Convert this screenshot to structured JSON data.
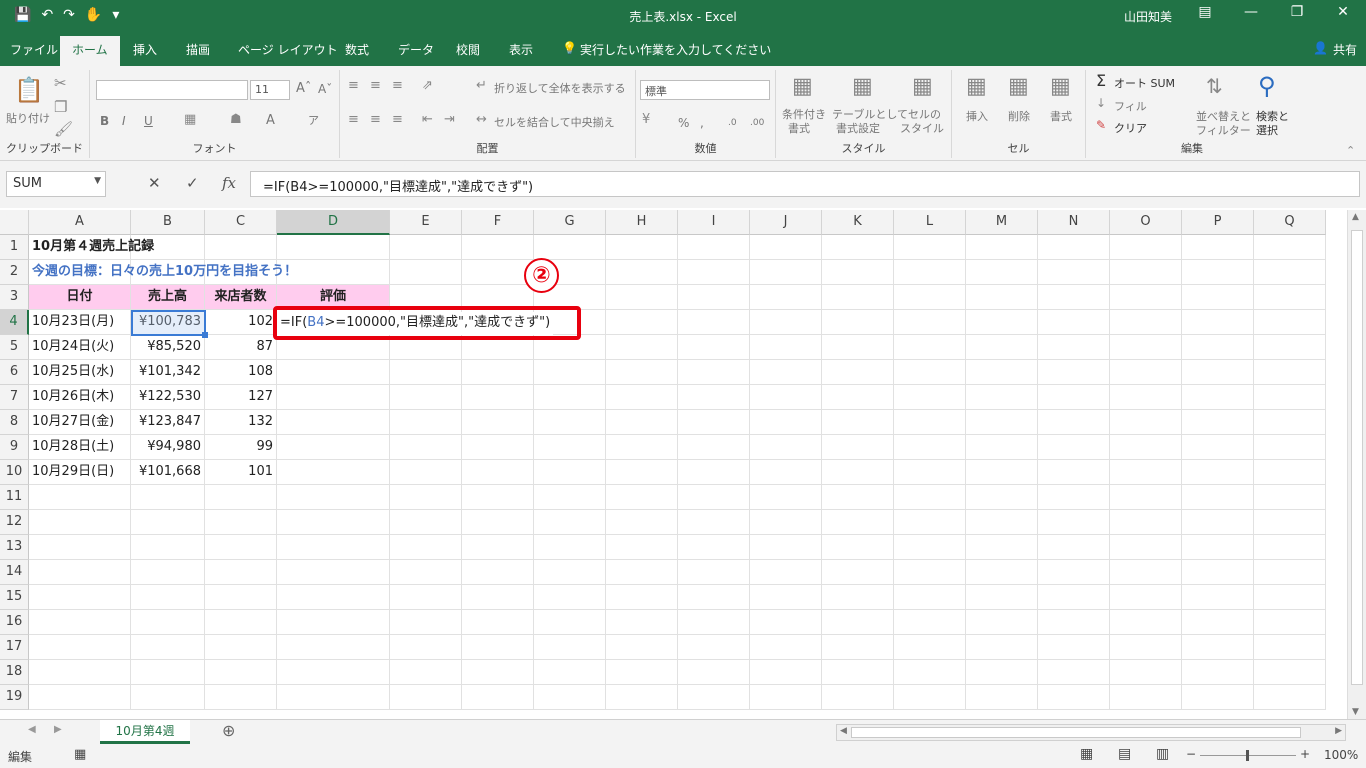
{
  "window": {
    "title": "売上表.xlsx  -  Excel",
    "user": "山田知美",
    "share": "共有"
  },
  "qat": {
    "save_icon": "save-icon",
    "undo_icon": "undo-icon",
    "redo_icon": "redo-icon",
    "touch_icon": "touch-mode-icon"
  },
  "menu": {
    "tabs": [
      "ファイル",
      "ホーム",
      "挿入",
      "描画",
      "ページ レイアウト",
      "数式",
      "データ",
      "校閲",
      "表示"
    ],
    "tellme": "実行したい作業を入力してください",
    "active": "ホーム"
  },
  "ribbon": {
    "clipboard": {
      "label": "クリップボード",
      "paste": "貼り付け"
    },
    "font": {
      "label": "フォント",
      "size": "11"
    },
    "align": {
      "label": "配置",
      "wrap": "折り返して全体を表示する",
      "merge": "セルを結合して中央揃え"
    },
    "number": {
      "label": "数値",
      "format": "標準"
    },
    "styles": {
      "label": "スタイル",
      "cond": "条件付き",
      "cond2": "書式",
      "table": "テーブルとして",
      "table2": "書式設定",
      "cellstyle": "セルの",
      "cellstyle2": "スタイル"
    },
    "cells": {
      "label": "セル",
      "insert": "挿入",
      "delete": "削除",
      "format": "書式"
    },
    "edit": {
      "label": "編集",
      "autosum": "オート SUM",
      "fill": "フィル",
      "clear": "クリア",
      "sort": "並べ替えと",
      "sort2": "フィルター",
      "find": "検索と",
      "find2": "選択"
    }
  },
  "formula_bar": {
    "name_box": "SUM",
    "formula": "=IF(B4>=100000,\"目標達成\",\"達成できず\")"
  },
  "columns": [
    "A",
    "B",
    "C",
    "D",
    "E",
    "F",
    "G",
    "H",
    "I",
    "J",
    "K",
    "L",
    "M",
    "N",
    "O",
    "P",
    "Q"
  ],
  "rows": [
    "1",
    "2",
    "3",
    "4",
    "5",
    "6",
    "7",
    "8",
    "9",
    "10",
    "11",
    "12",
    "13",
    "14",
    "15",
    "16",
    "17",
    "18",
    "19"
  ],
  "sheet": {
    "a1": "10月第４週売上記録",
    "a2": "今週の目標：日々の売上10万円を目指そう！",
    "headers": [
      "日付",
      "売上高",
      "来店者数",
      "評価"
    ],
    "data": [
      {
        "date": "10月23日(月)",
        "sales": "¥100,783",
        "visitors": "102"
      },
      {
        "date": "10月24日(火)",
        "sales": "¥85,520",
        "visitors": "87"
      },
      {
        "date": "10月25日(水)",
        "sales": "¥101,342",
        "visitors": "108"
      },
      {
        "date": "10月26日(木)",
        "sales": "¥122,530",
        "visitors": "127"
      },
      {
        "date": "10月27日(金)",
        "sales": "¥123,847",
        "visitors": "132"
      },
      {
        "date": "10月28日(土)",
        "sales": "¥94,980",
        "visitors": "99"
      },
      {
        "date": "10月29日(日)",
        "sales": "¥101,668",
        "visitors": "101"
      }
    ],
    "edit_prefix": "=IF(",
    "edit_ref": "B4",
    "edit_rest": ">=100000,\"目標達成\",\"達成できず\")"
  },
  "annotation": {
    "badge": "②",
    "color": "#e8000e"
  },
  "sheet_tab": "10月第4週",
  "status": {
    "mode": "編集",
    "zoom": "100%"
  },
  "colors": {
    "accent": "#217346",
    "header_fill": "#ffccee",
    "title_blue": "#4472c4"
  }
}
